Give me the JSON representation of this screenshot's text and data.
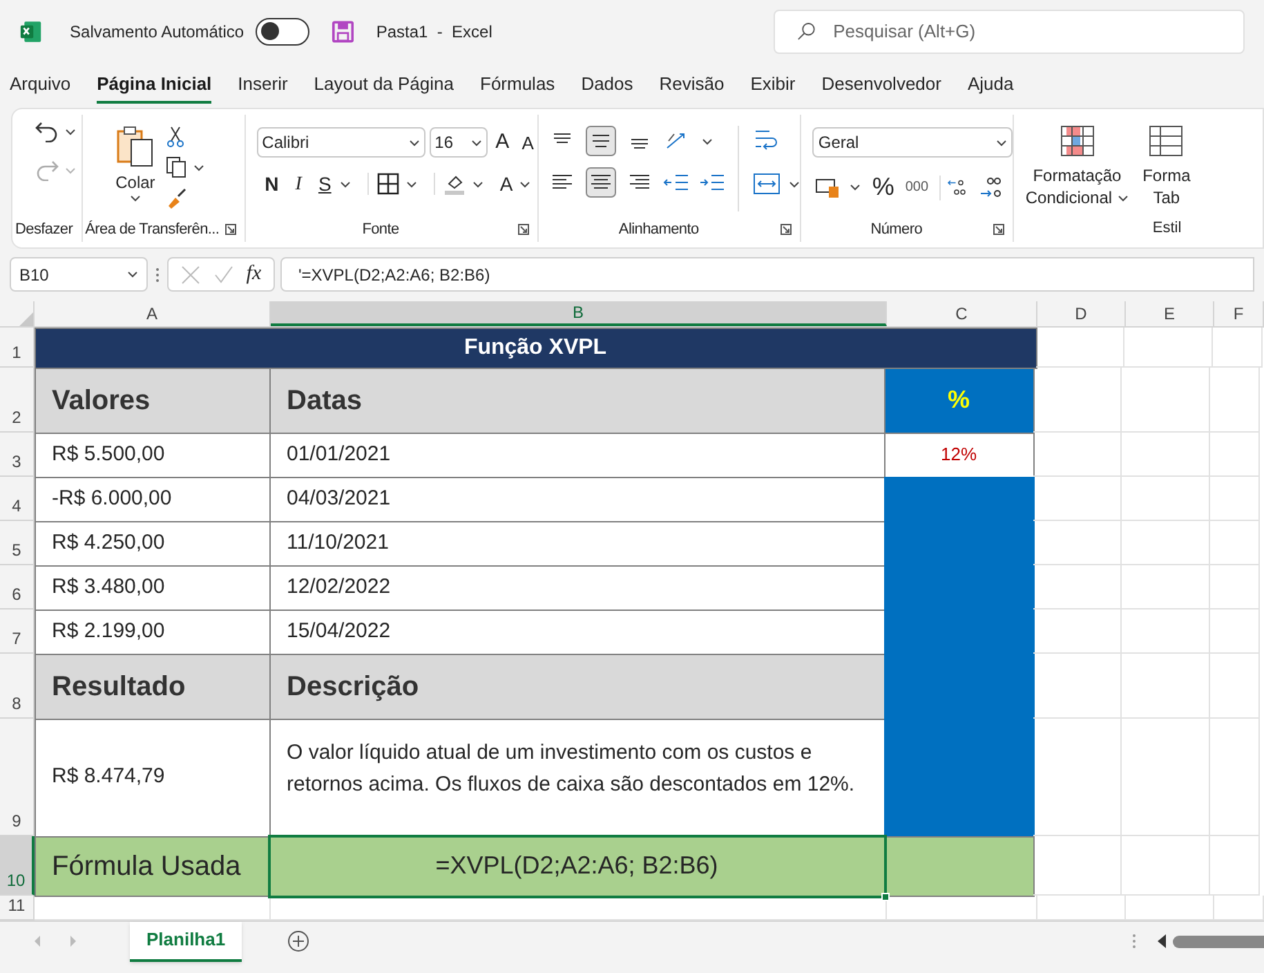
{
  "title_bar": {
    "autosave_label": "Salvamento Automático",
    "autosave_on": false,
    "document_title": "Pasta1  -  Excel",
    "search": {
      "placeholder": "Pesquisar (Alt+G)"
    }
  },
  "menu_tabs": [
    {
      "label": "Arquivo",
      "selected": false
    },
    {
      "label": "Página Inicial",
      "selected": true
    },
    {
      "label": "Inserir",
      "selected": false
    },
    {
      "label": "Layout da Página",
      "selected": false
    },
    {
      "label": "Fórmulas",
      "selected": false
    },
    {
      "label": "Dados",
      "selected": false
    },
    {
      "label": "Revisão",
      "selected": false
    },
    {
      "label": "Exibir",
      "selected": false
    },
    {
      "label": "Desenvolvedor",
      "selected": false
    },
    {
      "label": "Ajuda",
      "selected": false
    }
  ],
  "ribbon": {
    "undo": {
      "label": "Desfazer"
    },
    "clipboard": {
      "paste": "Colar",
      "label": "Área de Transferên..."
    },
    "font": {
      "name": "Calibri",
      "size": "16",
      "grow": "A",
      "shrink": "A",
      "bold": "N",
      "italic": "I",
      "underline": "S",
      "font_color": "A",
      "label": "Fonte"
    },
    "alignment": {
      "vertical": [
        {
          "selected": false
        },
        {
          "selected": true
        },
        {
          "selected": false
        }
      ],
      "horizontal": [
        {
          "selected": false
        },
        {
          "selected": true
        },
        {
          "selected": false
        }
      ],
      "label": "Alinhamento"
    },
    "number": {
      "format": "Geral",
      "percent": "%",
      "thousands": "000",
      "label": "Número"
    },
    "styles": {
      "conditional": [
        "Formatação",
        "Condicional"
      ],
      "table": [
        "Forma",
        "Tab"
      ],
      "label": "Estil"
    }
  },
  "formula_bar": {
    "name_box": "B10",
    "fx": "fx",
    "formula": "'=XVPL(D2;A2:A6; B2:B6)"
  },
  "columns": [
    {
      "label": "A",
      "selected": false
    },
    {
      "label": "B",
      "selected": true
    },
    {
      "label": "C",
      "selected": false
    },
    {
      "label": "D",
      "selected": false
    },
    {
      "label": "E",
      "selected": false
    },
    {
      "label": "F",
      "selected": false
    }
  ],
  "rows": [
    {
      "number": "1",
      "kind": "title",
      "selected": false,
      "cells": [
        {
          "text": "Função XVPL",
          "kind": "title",
          "selected": false
        }
      ]
    },
    {
      "number": "2",
      "kind": "header",
      "selected": false,
      "cells": [
        {
          "text": "Valores",
          "kind": "header",
          "selected": false
        },
        {
          "text": "Datas",
          "kind": "header",
          "selected": false
        },
        {
          "text": "%",
          "kind": "rate-label",
          "selected": false
        }
      ]
    },
    {
      "number": "3",
      "kind": "data",
      "selected": false,
      "cells": [
        {
          "text": "R$ 5.500,00",
          "kind": "data",
          "selected": false
        },
        {
          "text": "01/01/2021",
          "kind": "data",
          "selected": false
        },
        {
          "text": "12%",
          "kind": "rate",
          "selected": false
        }
      ]
    },
    {
      "number": "4",
      "kind": "data",
      "selected": false,
      "cells": [
        {
          "text": "-R$ 6.000,00",
          "kind": "data",
          "selected": false
        },
        {
          "text": "04/03/2021",
          "kind": "data",
          "selected": false
        },
        {
          "text": "",
          "kind": "fill",
          "selected": false
        }
      ]
    },
    {
      "number": "5",
      "kind": "data",
      "selected": false,
      "cells": [
        {
          "text": "R$ 4.250,00",
          "kind": "data",
          "selected": false
        },
        {
          "text": "11/10/2021",
          "kind": "data",
          "selected": false
        },
        {
          "text": "",
          "kind": "fill",
          "selected": false
        }
      ]
    },
    {
      "number": "6",
      "kind": "data",
      "selected": false,
      "cells": [
        {
          "text": "R$ 3.480,00",
          "kind": "data",
          "selected": false
        },
        {
          "text": "12/02/2022",
          "kind": "data",
          "selected": false
        },
        {
          "text": "",
          "kind": "fill",
          "selected": false
        }
      ]
    },
    {
      "number": "7",
      "kind": "data",
      "selected": false,
      "cells": [
        {
          "text": "R$ 2.199,00",
          "kind": "data",
          "selected": false
        },
        {
          "text": "15/04/2022",
          "kind": "data",
          "selected": false
        },
        {
          "text": "",
          "kind": "fill",
          "selected": false
        }
      ]
    },
    {
      "number": "8",
      "kind": "header",
      "selected": false,
      "cells": [
        {
          "text": "Resultado",
          "kind": "header",
          "selected": false
        },
        {
          "text": "Descrição",
          "kind": "header",
          "selected": false
        },
        {
          "text": "",
          "kind": "fill",
          "selected": false
        }
      ]
    },
    {
      "number": "9",
      "kind": "note",
      "selected": false,
      "cells": [
        {
          "text": "R$ 8.474,79",
          "kind": "data",
          "selected": false
        },
        {
          "text": "O valor líquido atual de um investimento com os custos e retornos acima. Os fluxos de caixa são descontados em 12%.",
          "kind": "note",
          "selected": false
        },
        {
          "text": "",
          "kind": "fill",
          "selected": false
        }
      ]
    },
    {
      "number": "10",
      "kind": "formula",
      "selected": true,
      "cells": [
        {
          "text": "Fórmula Usada",
          "kind": "formula-label",
          "selected": false
        },
        {
          "text": "=XVPL(D2;A2:A6; B2:B6)",
          "kind": "formula",
          "selected": true
        },
        {
          "text": "",
          "kind": "formula-fill",
          "selected": false
        }
      ]
    },
    {
      "number": "11",
      "kind": "blank",
      "selected": false,
      "cells": []
    }
  ],
  "sheet_tabs": [
    {
      "label": "Planilha1",
      "selected": true
    }
  ]
}
